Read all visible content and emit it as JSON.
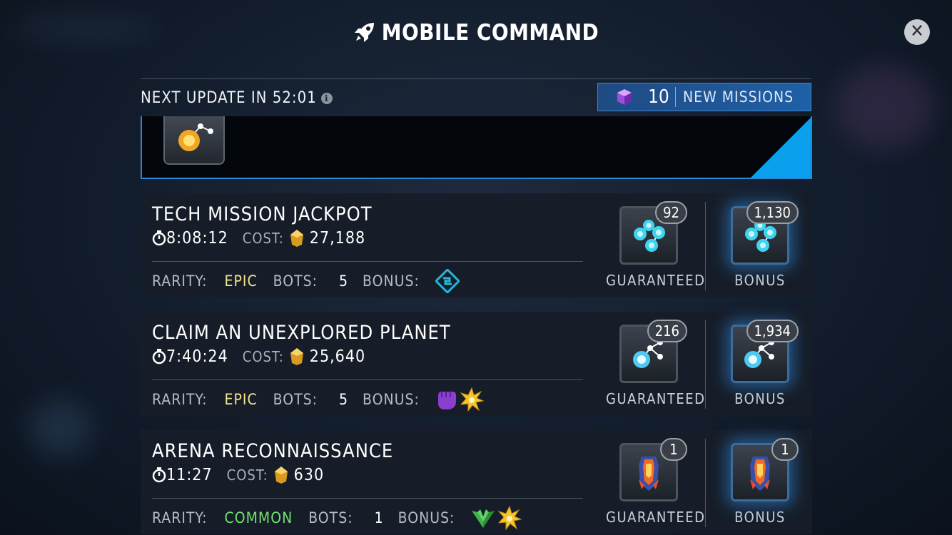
{
  "header": {
    "title": "MOBILE COMMAND",
    "close_label": "✕"
  },
  "update_bar": {
    "next_update_text": "NEXT UPDATE IN 52:01",
    "info_label": "i",
    "new_missions_count": "10",
    "new_missions_label": "NEW MISSIONS"
  },
  "missions": [
    {
      "title": "TECH MISSION JACKPOT",
      "timer": "8:08:12",
      "cost_label": "COST:",
      "cost": "27,188",
      "rarity_label": "RARITY:",
      "rarity": "EPIC",
      "bots_label": "BOTS:",
      "bots": "5",
      "bonus_label": "BONUS:",
      "bonus_icons": [
        "tech-class-icon"
      ],
      "guaranteed_count": "92",
      "guaranteed_label": "GUARANTEED",
      "bonus_count": "1,130",
      "bonus_reward_label": "BONUS",
      "reward_icon": "catalyst-fragment-icon"
    },
    {
      "title": "CLAIM AN UNEXPLORED PLANET",
      "timer": "7:40:24",
      "cost_label": "COST:",
      "cost": "25,640",
      "rarity_label": "RARITY:",
      "rarity": "EPIC",
      "bots_label": "BOTS:",
      "bots": "5",
      "bonus_label": "BONUS:",
      "bonus_icons": [
        "mutant-fist-icon",
        "cosmic-burst-icon"
      ],
      "guaranteed_count": "216",
      "guaranteed_label": "GUARANTEED",
      "bonus_count": "1,934",
      "bonus_reward_label": "BONUS",
      "reward_icon": "catalyst-fragment-icon"
    },
    {
      "title": "ARENA RECONNAISSANCE",
      "timer": "11:27",
      "cost_label": "COST:",
      "cost": "630",
      "rarity_label": "RARITY:",
      "rarity": "COMMON",
      "bots_label": "BOTS:",
      "bots": "1",
      "bonus_label": "BONUS:",
      "bonus_icons": [
        "skill-wings-icon",
        "cosmic-burst-icon"
      ],
      "guaranteed_count": "1",
      "guaranteed_label": "GUARANTEED",
      "bonus_count": "1",
      "bonus_reward_label": "BONUS",
      "reward_icon": "arena-boost-icon"
    }
  ],
  "colors": {
    "epic": "#f1e58a",
    "common": "#74e070",
    "accent": "#2a86d6"
  }
}
